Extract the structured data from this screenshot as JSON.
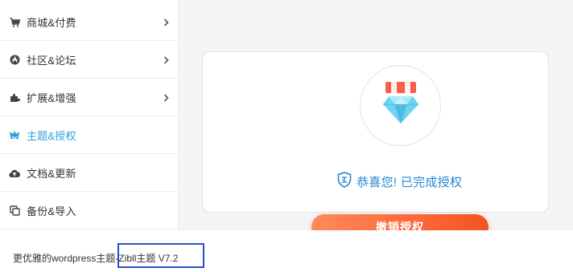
{
  "sidebar": {
    "items": [
      {
        "label": "商城&付费",
        "icon": "cart-icon",
        "has_arrow": true,
        "active": false
      },
      {
        "label": "社区&论坛",
        "icon": "community-icon",
        "has_arrow": true,
        "active": false
      },
      {
        "label": "扩展&增强",
        "icon": "puzzle-icon",
        "has_arrow": true,
        "active": false
      },
      {
        "label": "主题&授权",
        "icon": "theme-icon",
        "has_arrow": false,
        "active": true
      },
      {
        "label": "文档&更新",
        "icon": "cloud-upload-icon",
        "has_arrow": false,
        "active": false
      },
      {
        "label": "备份&导入",
        "icon": "copy-icon",
        "has_arrow": false,
        "active": false
      }
    ]
  },
  "auth": {
    "badge_icon": "diamond-shop-icon",
    "status_icon": "verified-shield-icon",
    "message": "恭喜您! 已完成授权",
    "revoke_label": "撤销授权"
  },
  "footer": {
    "text": "更优雅的wordpress主题-",
    "product": "Zibll主题 V7.2"
  },
  "colors": {
    "accent_blue": "#2585d0",
    "button_orange": "#ff6a3a",
    "highlight_box": "#2a4fc4"
  }
}
